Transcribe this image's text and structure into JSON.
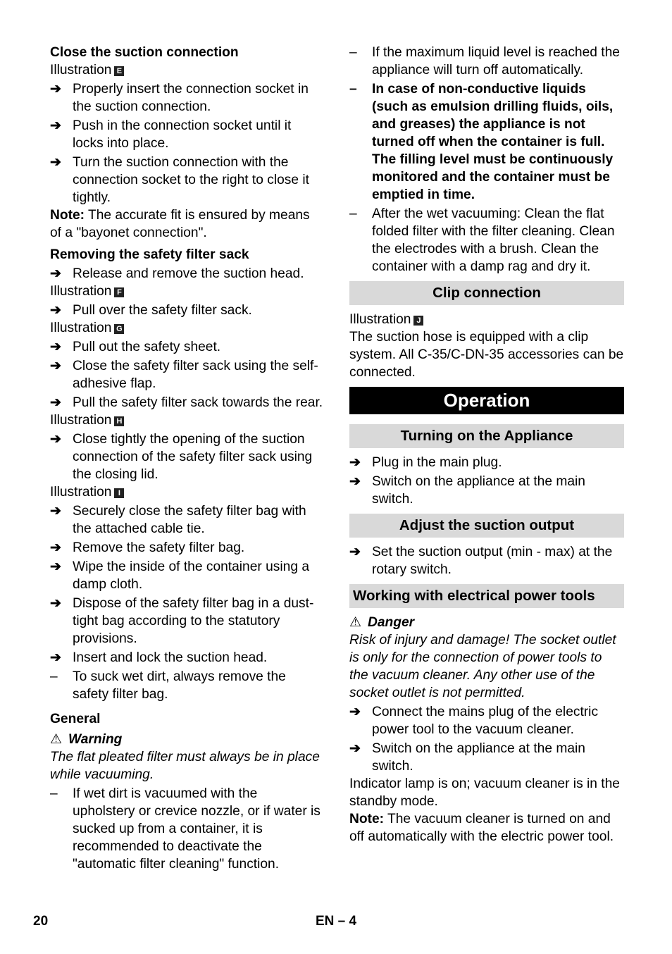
{
  "left": {
    "close_heading": "Close the suction connection",
    "illustration_label": "Illustration",
    "illus_E": "E",
    "close_steps": [
      "Properly insert the connection socket in the suction connection.",
      "Push in the connection socket until it locks into place.",
      "Turn the suction connection with the connection socket to the right to close it tightly."
    ],
    "note_label": "Note:",
    "note_text": " The accurate fit is ensured by means of a \"bayonet connection\".",
    "removing_heading": "Removing the safety filter sack",
    "remove_step1": "Release and remove the suction head.",
    "illus_F": "F",
    "step_F": "Pull over the safety filter sack.",
    "illus_G": "G",
    "steps_G": [
      "Pull out the safety sheet.",
      "Close the safety filter sack using the self-adhesive flap.",
      "Pull the safety filter sack towards the rear."
    ],
    "illus_H": "H",
    "step_H": "Close tightly the opening of the suction connection of the safety filter sack using the closing lid.",
    "illus_I": "I",
    "steps_I": [
      "Securely close the safety filter bag with the attached cable tie.",
      "Remove the safety filter bag.",
      "Wipe the inside of the container using a damp cloth.",
      "Dispose of the safety filter bag in a dust-tight bag according to the statutory provisions.",
      "Insert and lock the suction head."
    ],
    "dash_step": "To suck wet dirt, always remove the safety filter bag.",
    "general_heading": "General",
    "warning_label": "Warning",
    "warning_text": "The flat pleated filter must always be in place while vacuuming.",
    "general_dash": "If wet dirt is vacuumed with the upholstery or crevice nozzle, or if water is sucked up from a container, it is recommended to deactivate the \"automatic filter cleaning\" function."
  },
  "right": {
    "dash1": "If the maximum liquid level is reached the appliance will turn off automatically.",
    "dash2_bold": "In case of non-conductive liquids (such as emulsion drilling fluids, oils, and greases) the appliance is not turned off when the container is full. The filling level must be continuously monitored and the container must be emptied in time.",
    "dash3": "After the wet vacuuming: Clean the flat folded filter with the filter cleaning. Clean the electrodes with a brush. Clean the container with a damp rag and dry it.",
    "clip_heading": "Clip connection",
    "illus_J": "J",
    "clip_text": "The suction hose is equipped with a clip system. All C-35/C-DN-35 accessories can be connected.",
    "operation_heading": "Operation",
    "turning_heading": "Turning on the Appliance",
    "turning_steps": [
      "Plug in the main plug.",
      "Switch on the appliance at the main switch."
    ],
    "adjust_heading": "Adjust the suction output",
    "adjust_step": "Set the suction output (min - max) at the rotary switch.",
    "power_heading": "Working with electrical power tools",
    "danger_label": "Danger",
    "danger_text": "Risk of injury and damage! The socket outlet is only for the connection of power tools to the vacuum cleaner. Any other use of the socket outlet is not permitted.",
    "power_steps": [
      "Connect the mains plug of the electric power tool to the vacuum cleaner.",
      "Switch on the appliance at the main switch."
    ],
    "indicator_text": "Indicator lamp is on; vacuum cleaner is in the standby mode.",
    "note_label": "Note:",
    "note_text": " The vacuum cleaner is turned on and off automatically with the electric power tool."
  },
  "glyphs": {
    "arrow": "➔",
    "dash": "–",
    "warning_triangle": "⚠"
  },
  "footer": {
    "page_number": "20",
    "section_code": "EN – 4"
  }
}
